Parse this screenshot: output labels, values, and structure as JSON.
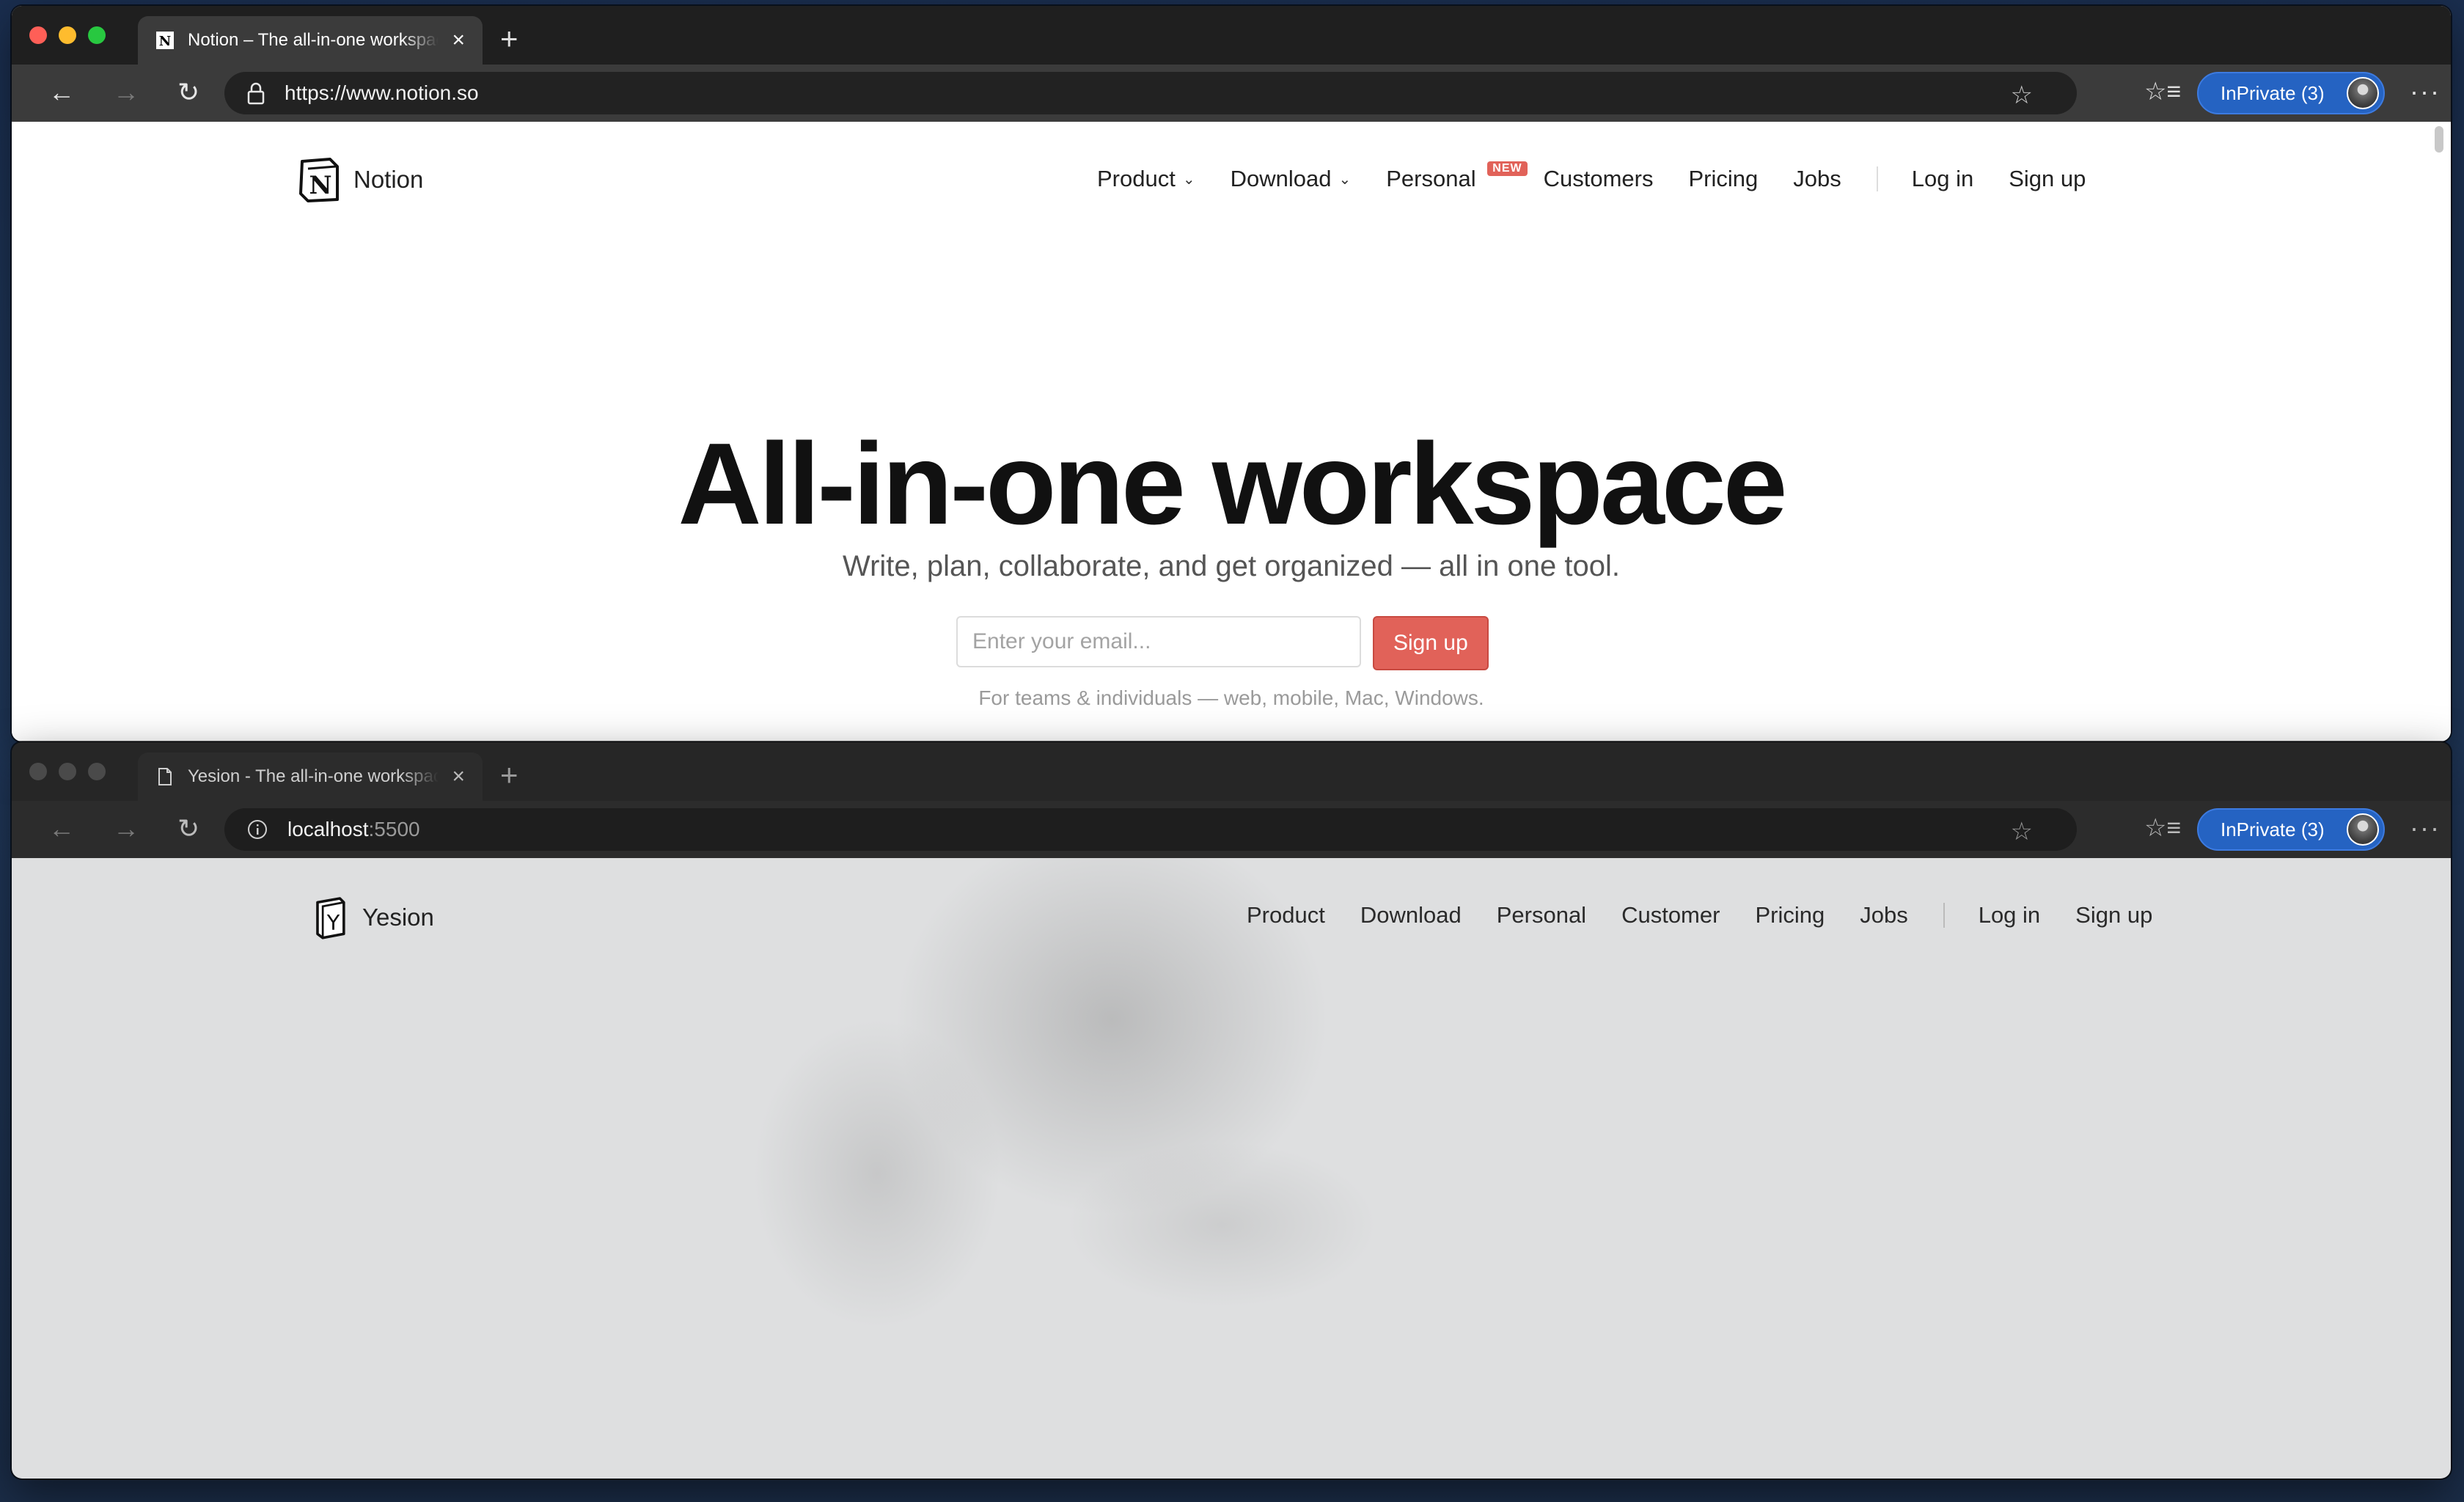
{
  "windows": [
    {
      "tab_title": "Notion – The all-in-one workspace",
      "url_main": "https://www.notion.so",
      "url_port": "",
      "inprivate_label": "InPrivate (3)",
      "site": {
        "logo_name": "Notion",
        "nav": [
          {
            "label": "Product",
            "has_chevron": true
          },
          {
            "label": "Download",
            "has_chevron": true
          },
          {
            "label": "Personal",
            "badge": "NEW"
          },
          {
            "label": "Customers"
          },
          {
            "label": "Pricing"
          },
          {
            "label": "Jobs"
          }
        ],
        "login": "Log in",
        "signup": "Sign up",
        "hero": {
          "title": "All-in-one workspace",
          "subtitle": "Write, plan, collaborate, and get organized — all in one tool.",
          "email_placeholder": "Enter your email...",
          "cta": "Sign up",
          "note": "For teams & individuals — web, mobile, Mac, Windows."
        }
      }
    },
    {
      "tab_title": "Yesion - The all-in-one workspace",
      "url_main": "localhost",
      "url_port": ":5500",
      "inprivate_label": "InPrivate (3)",
      "site": {
        "logo_name": "Yesion",
        "nav": [
          {
            "label": "Product"
          },
          {
            "label": "Download"
          },
          {
            "label": "Personal"
          },
          {
            "label": "Customer"
          },
          {
            "label": "Pricing"
          },
          {
            "label": "Jobs"
          }
        ],
        "login": "Log in",
        "signup": "Sign up"
      }
    }
  ],
  "icons": {
    "back": "back-arrow-icon",
    "forward": "forward-arrow-icon",
    "reload": "reload-icon",
    "lock": "lock-icon",
    "info": "info-icon",
    "favorite": "star-icon",
    "favorites": "favorites-icon",
    "more": "more-icon",
    "chevron": "chevron-down-icon"
  },
  "colors": {
    "signup_red": "#e16259",
    "inprivate_blue": "#2563c2",
    "badge_red": "#e16259"
  }
}
